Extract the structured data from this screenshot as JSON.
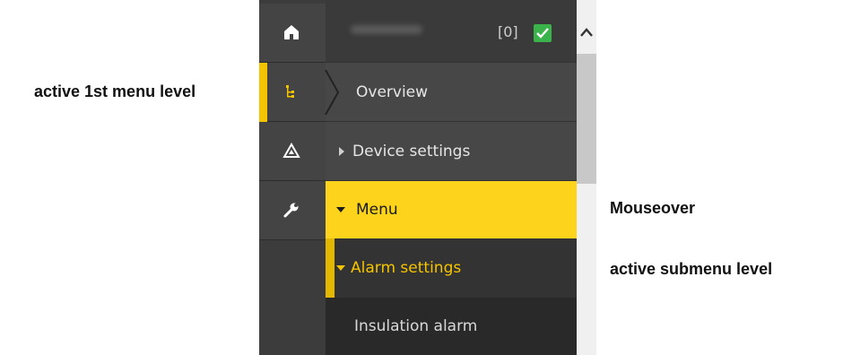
{
  "annotations": {
    "active_first": "active 1st menu level",
    "mouseover": "Mouseover",
    "active_sub": "active submenu level"
  },
  "rail": {
    "items": [
      {
        "icon": "home-icon",
        "active": false
      },
      {
        "icon": "tree-icon",
        "active": true
      },
      {
        "icon": "warning-icon",
        "active": false
      },
      {
        "icon": "wrench-icon",
        "active": false
      }
    ]
  },
  "header": {
    "count": "[0]",
    "status_icon": "check-icon"
  },
  "menu": {
    "overview": "Overview",
    "device_settings": "Device settings",
    "menu": "Menu",
    "alarm_settings": "Alarm settings",
    "insulation_alarm": "Insulation alarm"
  },
  "colors": {
    "accent": "#fdd41b",
    "active_text": "#f5c400",
    "rail_bg": "#444444",
    "menu_bg": "#474747",
    "status_ok": "#3ab34a"
  }
}
